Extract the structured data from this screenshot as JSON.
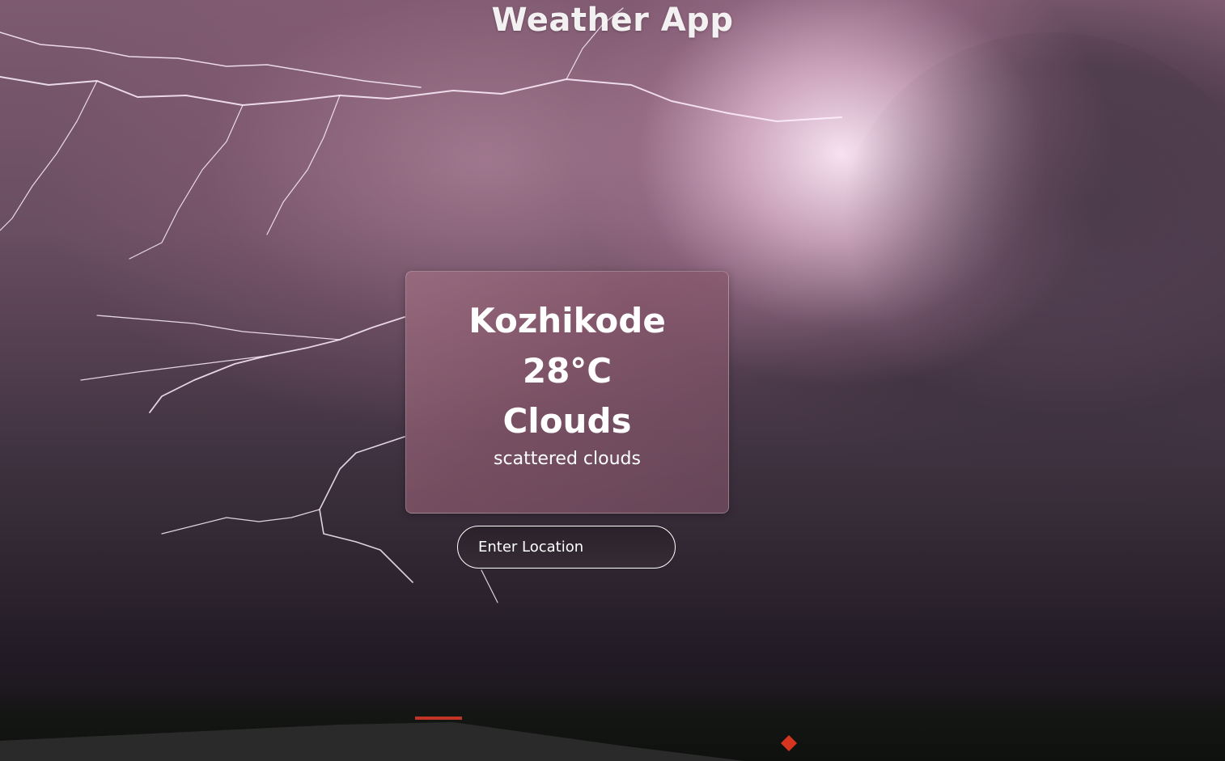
{
  "app": {
    "title": "Weather App"
  },
  "weather": {
    "city": "Kozhikode",
    "temperature": "28°C",
    "condition": "Clouds",
    "description": "scattered clouds"
  },
  "search": {
    "placeholder": "Enter Location",
    "value": ""
  },
  "colors": {
    "card_tint": "#9c6e82",
    "text": "#ffffff",
    "input_border": "#ffffff"
  }
}
